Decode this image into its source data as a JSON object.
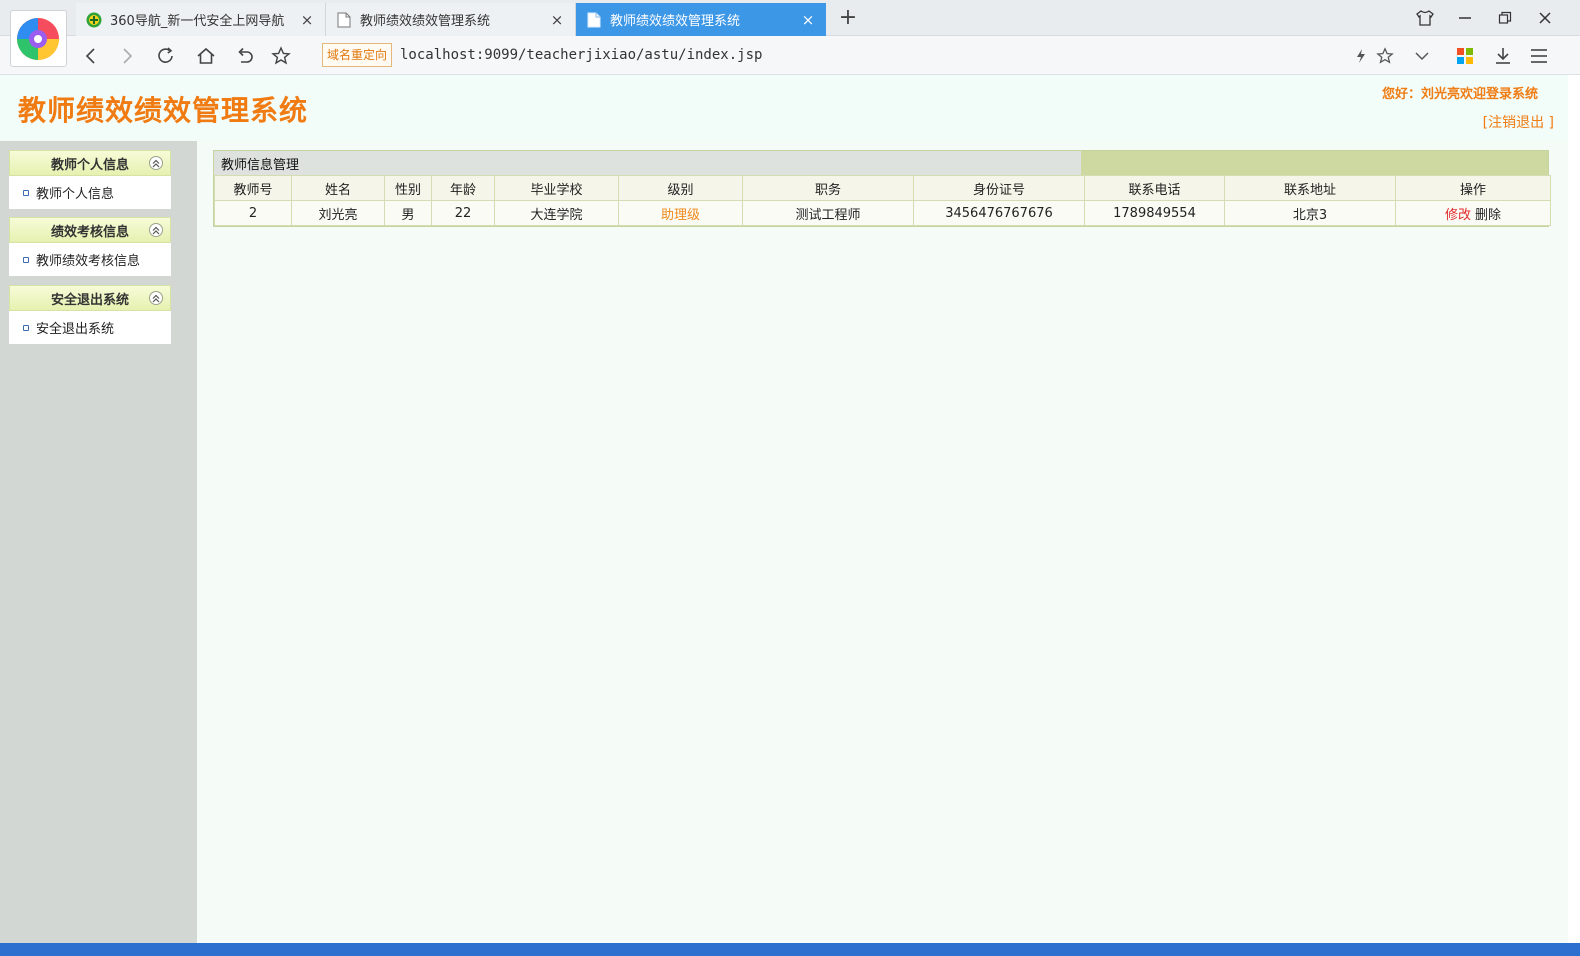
{
  "browser": {
    "tabs": [
      {
        "title": "360导航_新一代安全上网导航",
        "close": "×"
      },
      {
        "title": "教师绩效绩效管理系统",
        "close": "×"
      },
      {
        "title": "教师绩效绩效管理系统",
        "close": "×"
      }
    ],
    "new_tab": "+",
    "redirect_badge": "域名重定向",
    "address": "localhost:9099/teacherjixiao/astu/index.jsp"
  },
  "header": {
    "title": "教师绩效绩效管理系统",
    "welcome": "您好：刘光亮欢迎登录系统",
    "logout": "[注销退出  ]"
  },
  "sidebar": {
    "groups": [
      {
        "title": "教师个人信息",
        "item": "教师个人信息"
      },
      {
        "title": "绩效考核信息",
        "item": "教师绩效考核信息"
      },
      {
        "title": "安全退出系统",
        "item": "安全退出系统"
      }
    ]
  },
  "panel": {
    "title": "教师信息管理",
    "columns": [
      "教师号",
      "姓名",
      "性别",
      "年龄",
      "毕业学校",
      "级别",
      "职务",
      "身份证号",
      "联系电话",
      "联系地址",
      "操作"
    ],
    "rows": [
      {
        "id": "2",
        "name": "刘光亮",
        "gender": "男",
        "age": "22",
        "school": "大连学院",
        "level": "助理级",
        "position": "测试工程师",
        "id_card": "3456476767676",
        "phone": "1789849554",
        "address": "北京3",
        "edit": "修改",
        "delete": "删除"
      }
    ]
  },
  "colors": {
    "accent_orange": "#f07b12",
    "active_tab": "#3d97e7",
    "sidebar_bg": "#d2d7d3"
  }
}
